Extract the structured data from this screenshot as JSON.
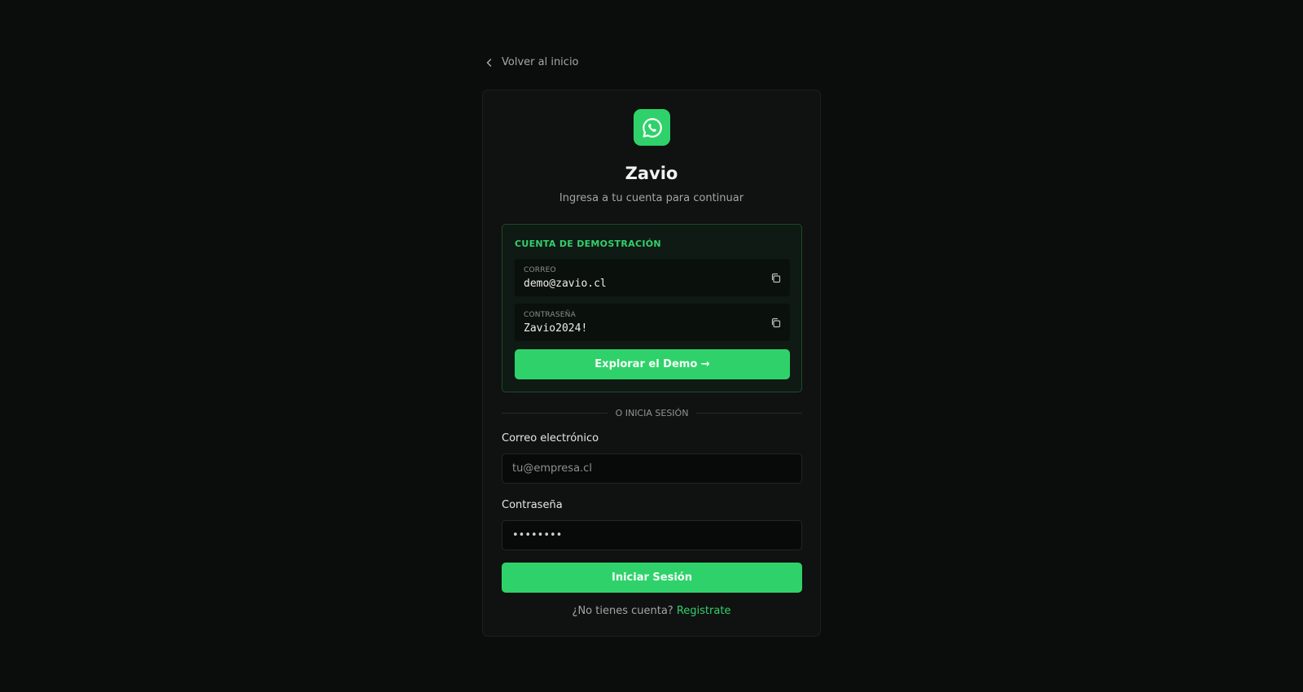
{
  "nav": {
    "back_label": "Volver al inicio"
  },
  "brand": {
    "logo_icon": "whatsapp-chat-icon",
    "name": "Zavio",
    "subtitle": "Ingresa a tu cuenta para continuar",
    "accent_color": "#2fd26a"
  },
  "demo": {
    "heading": "CUENTA DE DEMOSTRACIÓN",
    "email_label": "CORREO",
    "email_value": "demo@zavio.cl",
    "password_label": "CONTRASEÑA",
    "password_value": "Zavio2024!",
    "copy_icon": "copy-icon",
    "button_label": "Explorar el Demo →"
  },
  "divider_text": "O INICIA SESIÓN",
  "form": {
    "email_label": "Correo electrónico",
    "email_placeholder": "tu@empresa.cl",
    "email_value": "",
    "password_label": "Contraseña",
    "password_value": "12345678",
    "submit_label": "Iniciar Sesión"
  },
  "signup": {
    "prompt": "¿No tienes cuenta?",
    "link_label": "Registrate"
  }
}
